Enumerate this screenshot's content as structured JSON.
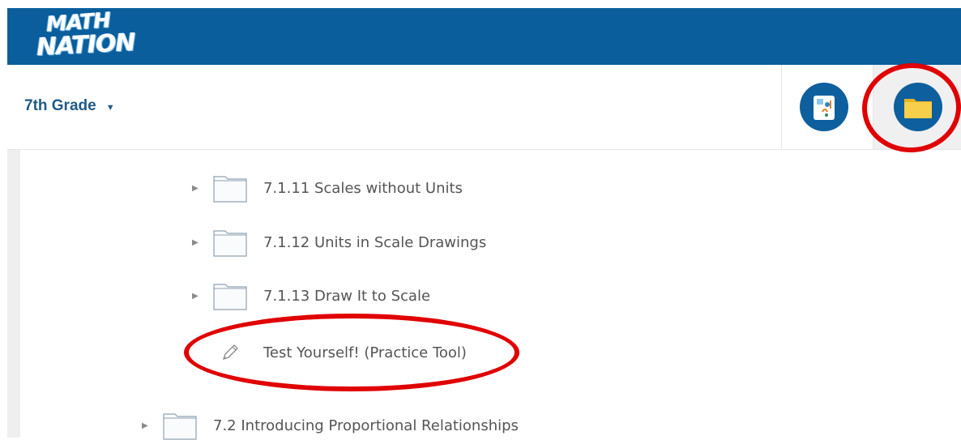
{
  "header": {
    "logo_line1": "MATH",
    "logo_line2": "NATION",
    "brand_color": "#0a5e9c"
  },
  "subbar": {
    "grade_label": "7th Grade",
    "grade_caret": "▼",
    "tools": [
      {
        "name": "whiteboard-tool"
      },
      {
        "name": "folder-tool"
      }
    ]
  },
  "tree": {
    "items": [
      {
        "label": "7.1.11 Scales without Units",
        "type": "folder"
      },
      {
        "label": "7.1.12 Units in Scale Drawings",
        "type": "folder"
      },
      {
        "label": "7.1.13 Draw It to Scale",
        "type": "folder"
      },
      {
        "label": "Test Yourself! (Practice Tool)",
        "type": "practice-tool"
      },
      {
        "label": "7.2 Introducing Proportional Relationships",
        "type": "folder"
      }
    ],
    "expand_glyph": "▶"
  },
  "annotations": {
    "highlight_color": "#e00000"
  }
}
